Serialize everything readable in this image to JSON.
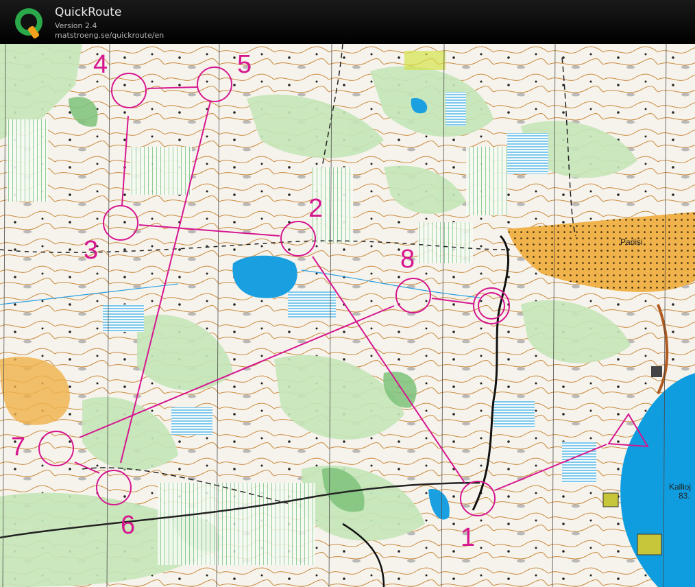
{
  "header": {
    "app_name": "QuickRoute",
    "version": "Version 2.4",
    "url": "matstroeng.se/quickroute/en"
  },
  "map": {
    "place_names": {
      "pariisi": "Pariisi",
      "kallioj": "Kallioj",
      "elevation": "83."
    },
    "course": {
      "color": "#d6168f",
      "control_labels": {
        "c1": "1",
        "c2": "2",
        "c3": "3",
        "c4": "4",
        "c5": "5",
        "c6": "6",
        "c7": "7",
        "c8": "8"
      }
    },
    "colors": {
      "open_land": "#f5f5f0",
      "forest_green": "#bfe3b4",
      "dark_green": "#7ec27a",
      "water": "#0f9de0",
      "marsh": "#5fc3e6",
      "yellow_field": "#f0b24a",
      "contour": "#c98a3e",
      "rock": "#b9b9b9"
    }
  }
}
